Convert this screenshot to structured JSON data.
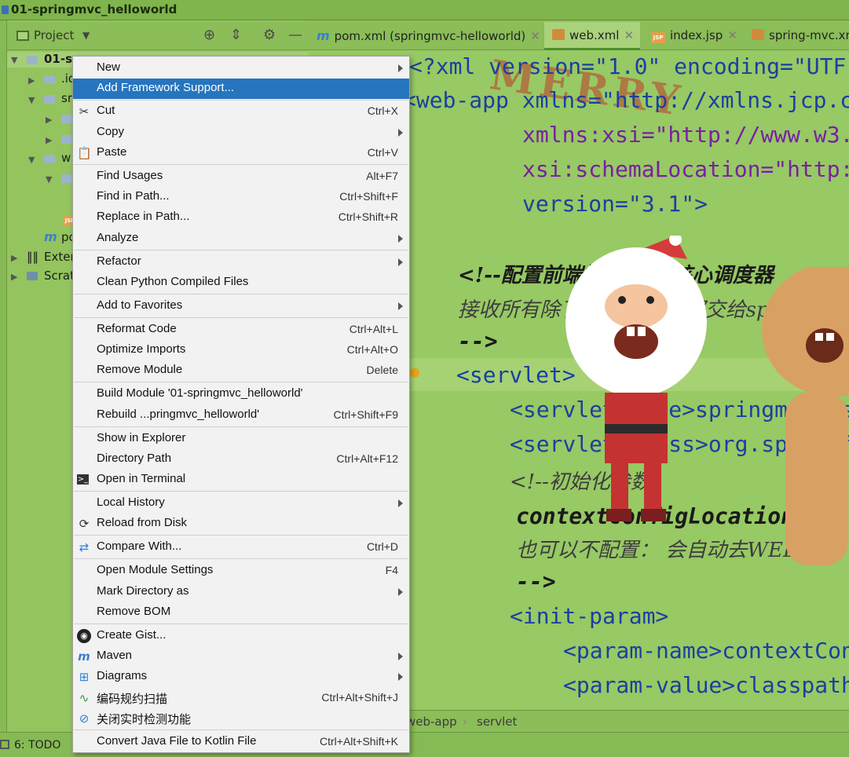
{
  "window": {
    "title": "01-springmvc_helloworld"
  },
  "project_panel": {
    "title": "Project",
    "tree": [
      {
        "label": "01-sp",
        "bold": true
      },
      {
        "label": ".id"
      },
      {
        "label": "sr"
      },
      {
        "label": ""
      },
      {
        "label": ""
      },
      {
        "label": "w"
      },
      {
        "label": ""
      },
      {
        "label": "pc"
      },
      {
        "label": "Exter"
      },
      {
        "label": "Scrat"
      }
    ]
  },
  "tabs": [
    {
      "label": "pom.xml (springmvc-helloworld)",
      "icon": "maven-icon"
    },
    {
      "label": "web.xml",
      "icon": "xml-icon",
      "active": true
    },
    {
      "label": "index.jsp",
      "icon": "jsp-icon"
    },
    {
      "label": "spring-mvc.xr",
      "icon": "xml-icon"
    }
  ],
  "editor": {
    "watermark": "MERRY",
    "lines": [
      "<?xml version=\"1.0\" encoding=\"UTF-",
      "<web-app xmlns=\"http://xmlns.jcp.c",
      "xmlns:xsi=\"http://www.w3.",
      "xsi:schemaLocation=\"http:",
      "version=\"3.1\">",
      "<!--配置前端控制器 、核心调度器",
      "接收所有除了.jsp的请求 都交给spr",
      "-->",
      "<servlet>",
      "<servlet-name>springmvc</s",
      "<servlet-class>org.springf",
      "<!--初始化参数",
      "contextConfigLocation 配",
      "也可以不配置： 会自动去WEB-I",
      "-->",
      "<init-param>",
      "<param-name>contextCon",
      "<param-value>classpath"
    ]
  },
  "breadcrumb": [
    "web-app",
    "servlet"
  ],
  "bottom": {
    "todo": "6: TODO"
  },
  "context_menu": {
    "items": [
      {
        "label": "New",
        "shortcut": "",
        "submenu": true,
        "icon": ""
      },
      {
        "label": "Add Framework Support...",
        "shortcut": "",
        "submenu": false,
        "icon": "",
        "selected": true
      },
      {
        "label": "Cut",
        "shortcut": "Ctrl+X",
        "submenu": false,
        "icon": "scissors-icon"
      },
      {
        "label": "Copy",
        "shortcut": "",
        "submenu": true,
        "icon": ""
      },
      {
        "label": "Paste",
        "shortcut": "Ctrl+V",
        "submenu": false,
        "icon": "clipboard-icon"
      },
      {
        "label": "Find Usages",
        "shortcut": "Alt+F7",
        "submenu": false,
        "icon": ""
      },
      {
        "label": "Find in Path...",
        "shortcut": "Ctrl+Shift+F",
        "submenu": false,
        "icon": ""
      },
      {
        "label": "Replace in Path...",
        "shortcut": "Ctrl+Shift+R",
        "submenu": false,
        "icon": ""
      },
      {
        "label": "Analyze",
        "shortcut": "",
        "submenu": true,
        "icon": ""
      },
      {
        "label": "Refactor",
        "shortcut": "",
        "submenu": true,
        "icon": ""
      },
      {
        "label": "Clean Python Compiled Files",
        "shortcut": "",
        "submenu": false,
        "icon": ""
      },
      {
        "label": "Add to Favorites",
        "shortcut": "",
        "submenu": true,
        "icon": ""
      },
      {
        "label": "Reformat Code",
        "shortcut": "Ctrl+Alt+L",
        "submenu": false,
        "icon": ""
      },
      {
        "label": "Optimize Imports",
        "shortcut": "Ctrl+Alt+O",
        "submenu": false,
        "icon": ""
      },
      {
        "label": "Remove Module",
        "shortcut": "Delete",
        "submenu": false,
        "icon": ""
      },
      {
        "label": "Build Module '01-springmvc_helloworld'",
        "shortcut": "",
        "submenu": false,
        "icon": ""
      },
      {
        "label": "Rebuild ...pringmvc_helloworld'",
        "shortcut": "Ctrl+Shift+F9",
        "submenu": false,
        "icon": ""
      },
      {
        "label": "Show in Explorer",
        "shortcut": "",
        "submenu": false,
        "icon": ""
      },
      {
        "label": "Directory Path",
        "shortcut": "Ctrl+Alt+F12",
        "submenu": false,
        "icon": ""
      },
      {
        "label": "Open in Terminal",
        "shortcut": "",
        "submenu": false,
        "icon": "terminal-icon"
      },
      {
        "label": "Local History",
        "shortcut": "",
        "submenu": true,
        "icon": ""
      },
      {
        "label": "Reload from Disk",
        "shortcut": "",
        "submenu": false,
        "icon": "reload-icon"
      },
      {
        "label": "Compare With...",
        "shortcut": "Ctrl+D",
        "submenu": false,
        "icon": "compare-icon"
      },
      {
        "label": "Open Module Settings",
        "shortcut": "F4",
        "submenu": false,
        "icon": ""
      },
      {
        "label": "Mark Directory as",
        "shortcut": "",
        "submenu": true,
        "icon": ""
      },
      {
        "label": "Remove BOM",
        "shortcut": "",
        "submenu": false,
        "icon": ""
      },
      {
        "label": "Create Gist...",
        "shortcut": "",
        "submenu": false,
        "icon": "github-icon"
      },
      {
        "label": "Maven",
        "shortcut": "",
        "submenu": true,
        "icon": "maven-icon"
      },
      {
        "label": "Diagrams",
        "shortcut": "",
        "submenu": true,
        "icon": "diagram-icon"
      },
      {
        "label": "编码规约扫描",
        "shortcut": "Ctrl+Alt+Shift+J",
        "submenu": false,
        "icon": "scan-icon"
      },
      {
        "label": "关闭实时检测功能",
        "shortcut": "",
        "submenu": false,
        "icon": "disable-icon"
      },
      {
        "label": "Convert Java File to Kotlin File",
        "shortcut": "Ctrl+Alt+Shift+K",
        "submenu": false,
        "icon": ""
      }
    ]
  },
  "colors": {
    "selection": "#2675bf",
    "theme_green": "#97c964"
  }
}
